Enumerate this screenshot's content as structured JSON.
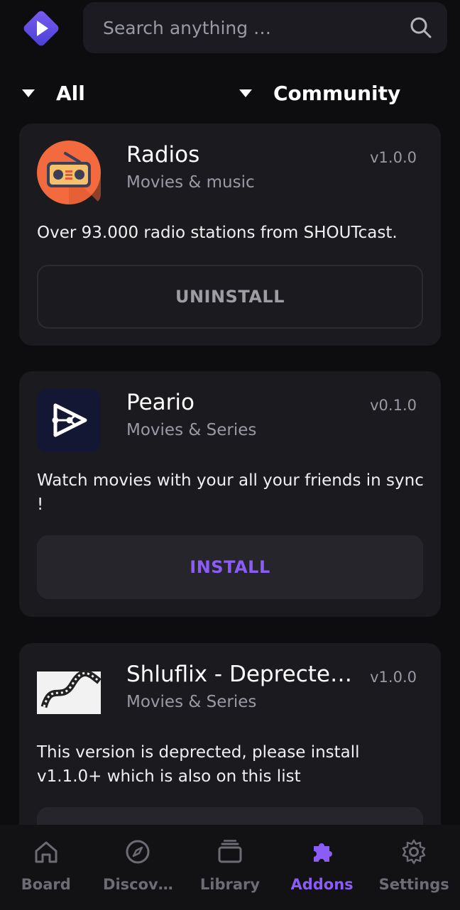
{
  "header": {
    "logo_icon": "stremio-logo-icon",
    "search_placeholder": "Search anything …"
  },
  "filters": [
    {
      "label": "All"
    },
    {
      "label": "Community"
    }
  ],
  "addons": [
    {
      "name": "Radios",
      "category": "Movies & music",
      "version": "v1.0.0",
      "description": "Over 93.000 radio stations from SHOUTcast.",
      "action": "UNINSTALL",
      "icon": "radio-icon"
    },
    {
      "name": "Peario",
      "category": "Movies & Series",
      "version": "v0.1.0",
      "description": "Watch movies with your all your friends in sync !",
      "action": "INSTALL",
      "icon": "share-play-icon"
    },
    {
      "name": "Shluflix - Deprecte…",
      "category": "Movies & Series",
      "version": "v1.0.0",
      "description": "This version is deprected, please install v1.1.0+ which is also on this list",
      "icon": "film-strip-icon"
    }
  ],
  "nav": [
    {
      "label": "Board",
      "icon": "home-icon",
      "active": false
    },
    {
      "label": "Discov…",
      "icon": "compass-icon",
      "active": false
    },
    {
      "label": "Library",
      "icon": "library-icon",
      "active": false
    },
    {
      "label": "Addons",
      "icon": "puzzle-icon",
      "active": true
    },
    {
      "label": "Settings",
      "icon": "gear-icon",
      "active": false
    }
  ],
  "colors": {
    "accent": "#8b5cf6",
    "background": "#0d0d10",
    "card": "#1a1a1f"
  }
}
